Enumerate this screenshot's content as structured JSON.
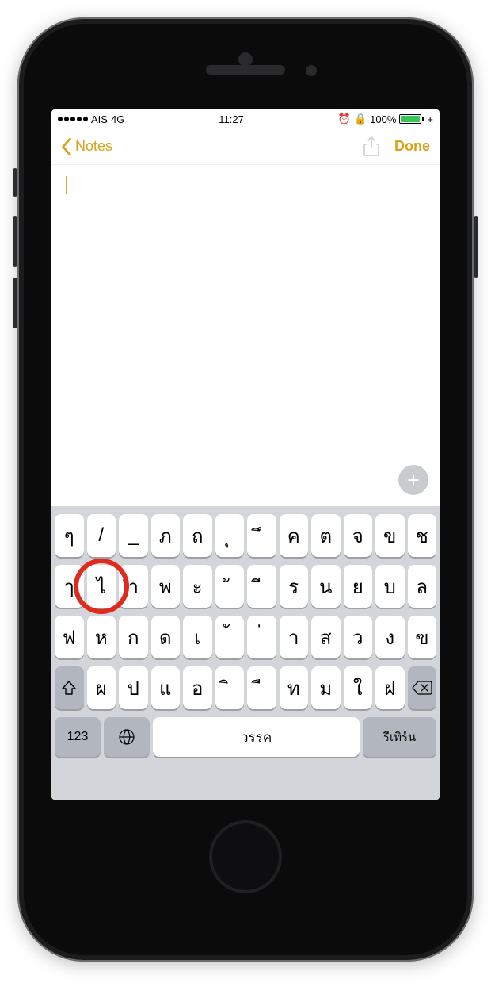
{
  "status_bar": {
    "carrier": "AIS",
    "network": "4G",
    "time": "11:27",
    "alarm_icon": "alarm-icon",
    "orientation_icon": "lock-rotation-icon",
    "battery_pct": "100%",
    "charging": "+"
  },
  "nav": {
    "back_label": "Notes",
    "share_icon": "share-icon",
    "done_label": "Done"
  },
  "note": {
    "content": "",
    "add_icon": "plus-icon"
  },
  "keyboard": {
    "row1": [
      "ๆ",
      "/",
      "_",
      "ภ",
      "ถ",
      "ุ",
      "ึ",
      "ค",
      "ต",
      "จ",
      "ข",
      "ช"
    ],
    "row2": [
      "ๅ",
      "ไ",
      "ำ",
      "พ",
      "ะ",
      "ั",
      "ี",
      "ร",
      "น",
      "ย",
      "บ",
      "ล"
    ],
    "row3": [
      "ฟ",
      "ห",
      "ก",
      "ด",
      "เ",
      "้",
      "่",
      "า",
      "ส",
      "ว",
      "ง",
      "ฃ"
    ],
    "row4_shift_icon": "shift-icon",
    "row4": [
      "ผ",
      "ป",
      "แ",
      "อ",
      "ิ",
      "ื",
      "ท",
      "ม",
      "ใ",
      "ฝ"
    ],
    "row4_del_icon": "backspace-icon",
    "row5": {
      "numbers_label": "123",
      "globe_icon": "globe-icon",
      "space_label": "วรรค",
      "return_label": "รีเทิร์น"
    }
  },
  "annotation": {
    "highlight_key_index_row2": 1
  },
  "colors": {
    "accent": "#d9a01b",
    "battery_fill": "#37c759",
    "annotation_red": "#e02a1d",
    "keyboard_bg": "#d2d5da",
    "fn_key_bg": "#b2b7bf"
  }
}
